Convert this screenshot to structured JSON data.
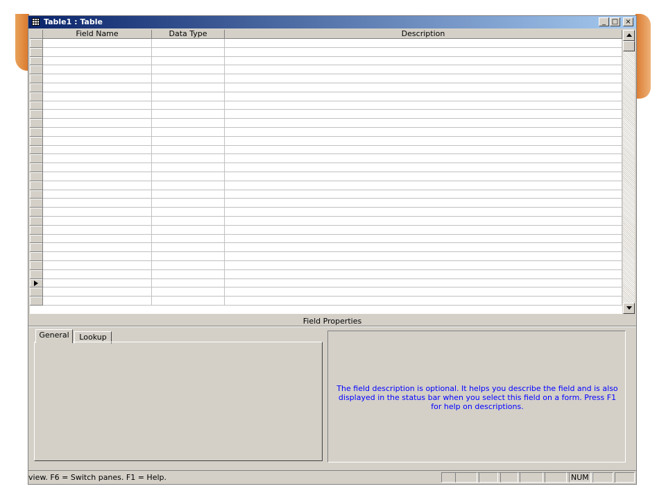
{
  "window": {
    "title": "Table1 : Table",
    "controls": {
      "minimize": "_",
      "maximize": "□",
      "close": "×"
    }
  },
  "grid": {
    "columns": [
      "Field Name",
      "Data Type",
      "Description"
    ],
    "row_count": 30,
    "current_row_index": 27
  },
  "field_properties": {
    "label": "Field Properties",
    "tabs": [
      "General",
      "Lookup"
    ],
    "active_tab": "General",
    "help_text": "The field description is optional.  It helps you describe the field and is also displayed in the status bar when you select this field on a form.  Press F1 for help on descriptions."
  },
  "status_bar": {
    "text": "view.  F6 = Switch panes.  F1 = Help.",
    "indicators": [
      "",
      "",
      "",
      "",
      "",
      "NUM",
      "",
      ""
    ]
  },
  "colors": {
    "title_gradient_start": "#0a246a",
    "title_gradient_end": "#a6caf0",
    "help_text": "#0000ff",
    "accent_orange": "#e08a3c"
  }
}
